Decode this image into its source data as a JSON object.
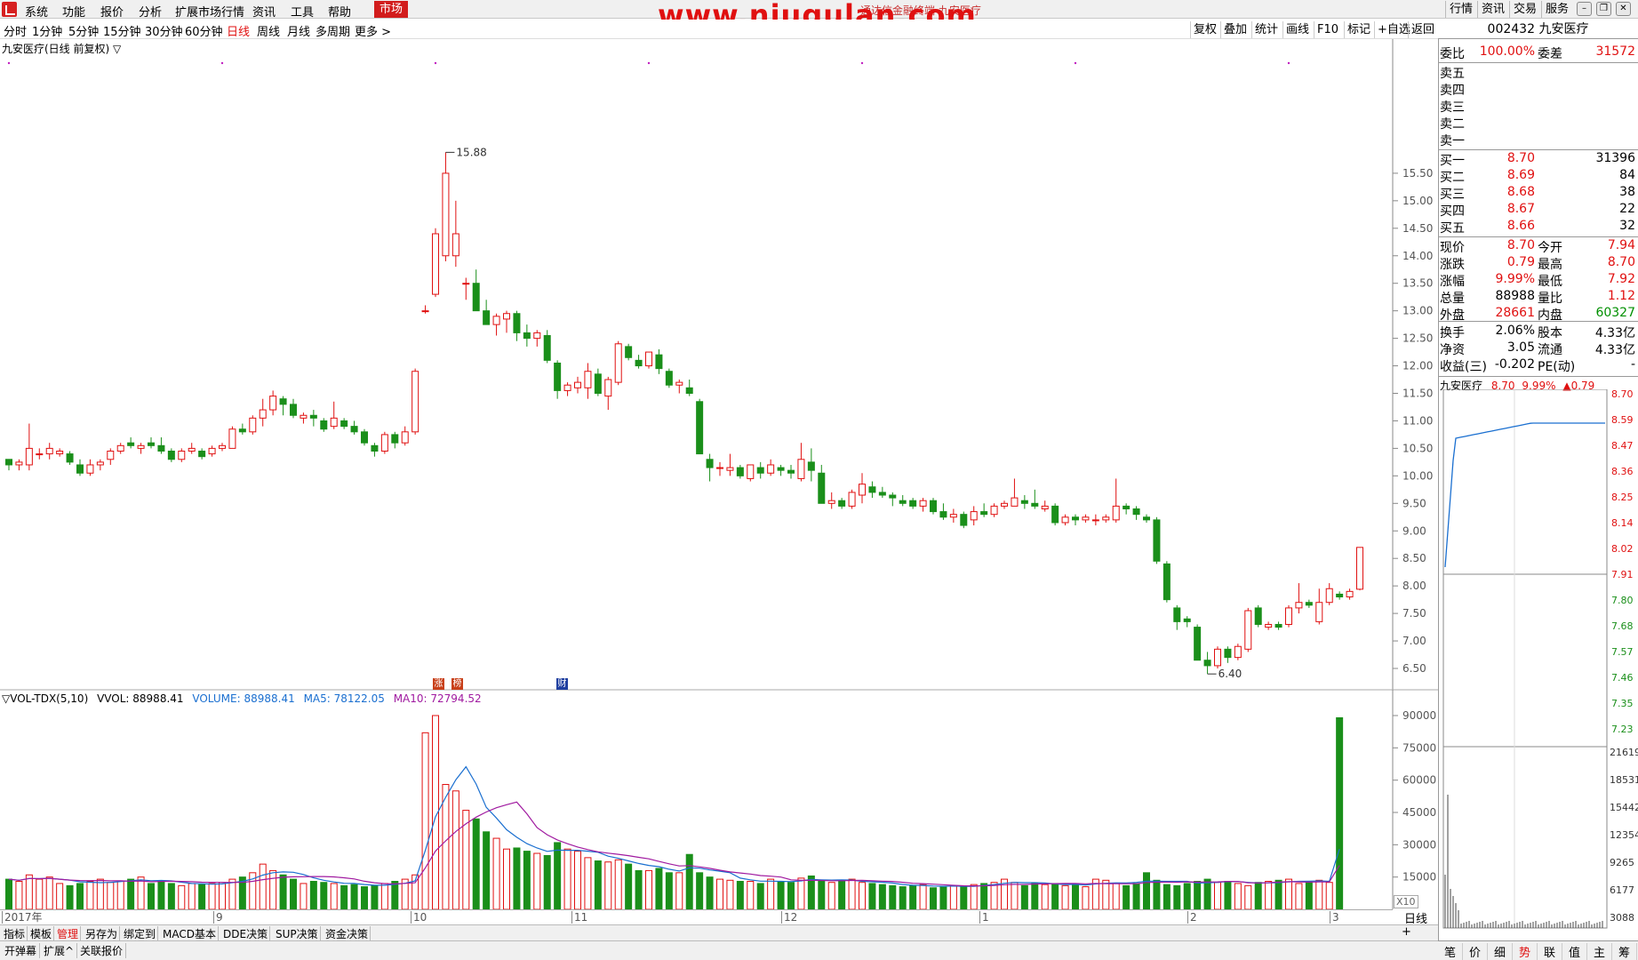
{
  "menu": {
    "items": [
      "系统",
      "功能",
      "报价",
      "分析",
      "扩展市场行情",
      "资讯",
      "工具",
      "帮助"
    ],
    "market": "市场",
    "watermark": "www.niugulan.com",
    "title": "通达信金融终端  九安医疗",
    "right_buttons": [
      "行情",
      "资讯",
      "交易",
      "服务"
    ]
  },
  "periods": [
    "分时",
    "1分钟",
    "5分钟",
    "15分钟",
    "30分钟",
    "60分钟",
    "日线",
    "周线",
    "月线",
    "多周期",
    "更多 >"
  ],
  "active_period": "日线",
  "toolbar": [
    "复权",
    "叠加",
    "统计",
    "画线",
    "F10",
    "标记",
    "+自选",
    "返回"
  ],
  "chart": {
    "title": "九安医疗(日线 前复权) ▽",
    "high_label": "15.88",
    "low_label": "6.40",
    "date_labels": [
      "2017年",
      "9",
      "10",
      "11",
      "12",
      "1",
      "2",
      "3"
    ],
    "freq_label": "日线",
    "x10_label": "X10",
    "badges": [
      "涨",
      "榜",
      "财"
    ]
  },
  "volume": {
    "name": "▽VOL-TDX(5,10)",
    "vvol": "VVOL: 88988.41",
    "volume": "VOLUME: 88988.41",
    "ma5": "MA5: 78122.05",
    "ma10": "MA10: 72794.52"
  },
  "bottom_tabs": [
    "指标",
    "模板",
    "管理",
    "另存为",
    "绑定到",
    "MACD基本",
    "DDE决策",
    "SUP决策",
    "资金决策"
  ],
  "active_tab": "管理",
  "bottom_bar": [
    "开弹幕",
    "扩展^",
    "关联报价"
  ],
  "plus_label": "+",
  "quote": {
    "code_name": "002432 九安医疗",
    "weibi_label": "委比",
    "weibi": "100.00%",
    "weicha_label": "委差",
    "weicha": "31572",
    "sell": [
      {
        "label": "卖五",
        "price": "",
        "vol": ""
      },
      {
        "label": "卖四",
        "price": "",
        "vol": ""
      },
      {
        "label": "卖三",
        "price": "",
        "vol": ""
      },
      {
        "label": "卖二",
        "price": "",
        "vol": ""
      },
      {
        "label": "卖一",
        "price": "",
        "vol": ""
      }
    ],
    "buy": [
      {
        "label": "买一",
        "price": "8.70",
        "vol": "31396"
      },
      {
        "label": "买二",
        "price": "8.69",
        "vol": "84"
      },
      {
        "label": "买三",
        "price": "8.68",
        "vol": "38"
      },
      {
        "label": "买四",
        "price": "8.67",
        "vol": "22"
      },
      {
        "label": "买五",
        "price": "8.66",
        "vol": "32"
      }
    ],
    "stats": [
      {
        "l1": "现价",
        "v1": "8.70",
        "c1": "red",
        "l2": "今开",
        "v2": "7.94",
        "c2": "red"
      },
      {
        "l1": "涨跌",
        "v1": "0.79",
        "c1": "red",
        "l2": "最高",
        "v2": "8.70",
        "c2": "red"
      },
      {
        "l1": "涨幅",
        "v1": "9.99%",
        "c1": "red",
        "l2": "最低",
        "v2": "7.92",
        "c2": "red"
      },
      {
        "l1": "总量",
        "v1": "88988",
        "c1": "",
        "l2": "量比",
        "v2": "1.12",
        "c2": "red"
      },
      {
        "l1": "外盘",
        "v1": "28661",
        "c1": "red",
        "l2": "内盘",
        "v2": "60327",
        "c2": "green"
      }
    ],
    "fundamentals": [
      {
        "l1": "换手",
        "v1": "2.06%",
        "l2": "股本",
        "v2": "4.33亿"
      },
      {
        "l1": "净资",
        "v1": "3.05",
        "l2": "流通",
        "v2": "4.33亿"
      },
      {
        "l1": "收益(三)",
        "v1": "-0.202",
        "l2": "PE(动)",
        "v2": "-"
      }
    ]
  },
  "mini": {
    "name": "九安医疗",
    "price": "8.70",
    "pct": "9.99%",
    "chg": "▲0.79",
    "price_ticks": [
      "8.70",
      "8.59",
      "8.47",
      "8.36",
      "8.25",
      "8.14",
      "8.02",
      "7.91",
      "7.80",
      "7.68",
      "7.57",
      "7.46",
      "7.35",
      "7.23"
    ],
    "vol_ticks": [
      "21619",
      "18531",
      "15442",
      "12354",
      "9265",
      "6177",
      "3088"
    ]
  },
  "right_bottom": [
    "笔",
    "价",
    "细",
    "势",
    "联",
    "值",
    "主",
    "筹"
  ],
  "right_active": "势",
  "colors": {
    "up": "#e01010",
    "down": "#1a8f1a",
    "ma5": "#1a6fd0",
    "ma10": "#a01aa0",
    "bg": "#ffffff"
  },
  "chart_data": {
    "type": "candlestick",
    "price_axis": [
      6.5,
      7.0,
      7.5,
      8.0,
      8.5,
      9.0,
      9.5,
      10.0,
      10.5,
      11.0,
      11.5,
      12.0,
      12.5,
      13.0,
      13.5,
      14.0,
      14.5,
      15.0,
      15.5
    ],
    "volume_axis": [
      15000,
      30000,
      45000,
      60000,
      75000,
      90000
    ],
    "ohlc": [
      [
        10.3,
        10.3,
        10.1,
        10.2
      ],
      [
        10.2,
        10.3,
        10.1,
        10.25
      ],
      [
        10.2,
        10.95,
        10.1,
        10.5
      ],
      [
        10.4,
        10.5,
        10.3,
        10.4
      ],
      [
        10.4,
        10.6,
        10.3,
        10.5
      ],
      [
        10.4,
        10.5,
        10.35,
        10.45
      ],
      [
        10.4,
        10.45,
        10.2,
        10.25
      ],
      [
        10.2,
        10.3,
        10.0,
        10.05
      ],
      [
        10.05,
        10.3,
        10.0,
        10.2
      ],
      [
        10.2,
        10.3,
        10.1,
        10.25
      ],
      [
        10.3,
        10.5,
        10.2,
        10.45
      ],
      [
        10.45,
        10.6,
        10.4,
        10.55
      ],
      [
        10.6,
        10.7,
        10.5,
        10.55
      ],
      [
        10.5,
        10.6,
        10.4,
        10.55
      ],
      [
        10.6,
        10.7,
        10.5,
        10.55
      ],
      [
        10.55,
        10.7,
        10.4,
        10.45
      ],
      [
        10.45,
        10.5,
        10.25,
        10.3
      ],
      [
        10.3,
        10.5,
        10.25,
        10.45
      ],
      [
        10.45,
        10.6,
        10.4,
        10.5
      ],
      [
        10.45,
        10.5,
        10.3,
        10.35
      ],
      [
        10.4,
        10.55,
        10.35,
        10.5
      ],
      [
        10.5,
        10.6,
        10.45,
        10.55
      ],
      [
        10.5,
        10.9,
        10.5,
        10.85
      ],
      [
        10.85,
        10.95,
        10.75,
        10.8
      ],
      [
        10.8,
        11.1,
        10.75,
        11.05
      ],
      [
        11.05,
        11.4,
        10.9,
        11.2
      ],
      [
        11.2,
        11.55,
        11.1,
        11.45
      ],
      [
        11.4,
        11.45,
        11.1,
        11.3
      ],
      [
        11.3,
        11.4,
        11.05,
        11.1
      ],
      [
        11.05,
        11.15,
        10.95,
        11.1
      ],
      [
        11.1,
        11.2,
        10.9,
        11.05
      ],
      [
        11.0,
        11.05,
        10.8,
        10.85
      ],
      [
        10.9,
        11.35,
        10.85,
        11.05
      ],
      [
        11.0,
        11.05,
        10.85,
        10.9
      ],
      [
        10.9,
        11.0,
        10.75,
        10.8
      ],
      [
        10.8,
        10.85,
        10.55,
        10.6
      ],
      [
        10.55,
        10.6,
        10.35,
        10.45
      ],
      [
        10.45,
        10.8,
        10.4,
        10.75
      ],
      [
        10.75,
        10.8,
        10.5,
        10.6
      ],
      [
        10.6,
        10.9,
        10.55,
        10.8
      ],
      [
        10.8,
        11.95,
        10.75,
        11.9
      ],
      [
        13.0,
        13.1,
        12.95,
        13.0
      ],
      [
        13.3,
        14.5,
        13.25,
        14.4
      ],
      [
        14.0,
        15.88,
        13.9,
        15.5
      ],
      [
        14.0,
        15.0,
        13.8,
        14.4
      ],
      [
        13.5,
        13.6,
        13.2,
        13.5
      ],
      [
        13.5,
        13.75,
        13.05,
        13.0
      ],
      [
        13.0,
        13.2,
        12.75,
        12.75
      ],
      [
        12.75,
        12.95,
        12.55,
        12.9
      ],
      [
        12.85,
        13.0,
        12.6,
        12.95
      ],
      [
        12.95,
        13.0,
        12.45,
        12.6
      ],
      [
        12.6,
        12.75,
        12.35,
        12.5
      ],
      [
        12.5,
        12.65,
        12.35,
        12.6
      ],
      [
        12.55,
        12.65,
        12.05,
        12.1
      ],
      [
        12.05,
        12.1,
        11.4,
        11.55
      ],
      [
        11.55,
        11.7,
        11.45,
        11.65
      ],
      [
        11.6,
        11.8,
        11.5,
        11.7
      ],
      [
        11.6,
        12.05,
        11.4,
        11.9
      ],
      [
        11.85,
        11.95,
        11.45,
        11.5
      ],
      [
        11.45,
        11.8,
        11.2,
        11.75
      ],
      [
        11.7,
        12.45,
        11.65,
        12.4
      ],
      [
        12.35,
        12.4,
        12.1,
        12.15
      ],
      [
        12.1,
        12.2,
        11.95,
        12.0
      ],
      [
        12.0,
        12.25,
        11.95,
        12.25
      ],
      [
        12.2,
        12.3,
        11.85,
        11.95
      ],
      [
        11.9,
        11.95,
        11.6,
        11.65
      ],
      [
        11.65,
        11.75,
        11.5,
        11.7
      ],
      [
        11.6,
        11.75,
        11.45,
        11.5
      ],
      [
        11.35,
        11.4,
        10.4,
        10.4
      ],
      [
        10.3,
        10.4,
        9.9,
        10.15
      ],
      [
        10.15,
        10.25,
        10.0,
        10.15
      ],
      [
        10.1,
        10.4,
        10.0,
        10.15
      ],
      [
        10.15,
        10.2,
        9.95,
        10.0
      ],
      [
        9.95,
        10.2,
        9.9,
        10.2
      ],
      [
        10.15,
        10.25,
        9.95,
        10.05
      ],
      [
        10.05,
        10.3,
        10.0,
        10.2
      ],
      [
        10.15,
        10.2,
        10.0,
        10.1
      ],
      [
        10.1,
        10.2,
        9.95,
        10.05
      ],
      [
        9.95,
        10.6,
        9.9,
        10.3
      ],
      [
        10.25,
        10.5,
        9.9,
        10.1
      ],
      [
        10.05,
        10.2,
        9.5,
        9.5
      ],
      [
        9.5,
        9.7,
        9.4,
        9.55
      ],
      [
        9.55,
        9.6,
        9.4,
        9.45
      ],
      [
        9.45,
        9.75,
        9.4,
        9.7
      ],
      [
        9.65,
        10.05,
        9.5,
        9.85
      ],
      [
        9.8,
        9.9,
        9.6,
        9.7
      ],
      [
        9.7,
        9.8,
        9.6,
        9.65
      ],
      [
        9.65,
        9.7,
        9.45,
        9.6
      ],
      [
        9.55,
        9.65,
        9.45,
        9.5
      ],
      [
        9.55,
        9.6,
        9.4,
        9.45
      ],
      [
        9.45,
        9.6,
        9.35,
        9.55
      ],
      [
        9.55,
        9.6,
        9.3,
        9.35
      ],
      [
        9.35,
        9.5,
        9.2,
        9.25
      ],
      [
        9.25,
        9.4,
        9.15,
        9.3
      ],
      [
        9.3,
        9.35,
        9.05,
        9.1
      ],
      [
        9.2,
        9.45,
        9.1,
        9.35
      ],
      [
        9.35,
        9.5,
        9.25,
        9.3
      ],
      [
        9.3,
        9.5,
        9.25,
        9.45
      ],
      [
        9.45,
        9.55,
        9.4,
        9.5
      ],
      [
        9.45,
        9.95,
        9.45,
        9.6
      ],
      [
        9.55,
        9.65,
        9.4,
        9.5
      ],
      [
        9.5,
        9.75,
        9.4,
        9.45
      ],
      [
        9.4,
        9.55,
        9.35,
        9.45
      ],
      [
        9.45,
        9.5,
        9.1,
        9.15
      ],
      [
        9.15,
        9.3,
        9.1,
        9.25
      ],
      [
        9.25,
        9.3,
        9.1,
        9.2
      ],
      [
        9.2,
        9.3,
        9.15,
        9.25
      ],
      [
        9.2,
        9.3,
        9.1,
        9.2
      ],
      [
        9.2,
        9.3,
        9.15,
        9.25
      ],
      [
        9.2,
        9.95,
        9.15,
        9.45
      ],
      [
        9.45,
        9.5,
        9.3,
        9.4
      ],
      [
        9.4,
        9.45,
        9.2,
        9.3
      ],
      [
        9.25,
        9.3,
        9.15,
        9.2
      ],
      [
        9.2,
        9.25,
        8.4,
        8.45
      ],
      [
        8.4,
        8.45,
        7.7,
        7.75
      ],
      [
        7.6,
        7.65,
        7.2,
        7.35
      ],
      [
        7.4,
        7.45,
        7.25,
        7.35
      ],
      [
        7.25,
        7.3,
        6.65,
        6.65
      ],
      [
        6.65,
        6.8,
        6.4,
        6.55
      ],
      [
        6.55,
        6.9,
        6.5,
        6.85
      ],
      [
        6.85,
        6.9,
        6.6,
        6.7
      ],
      [
        6.7,
        6.95,
        6.65,
        6.9
      ],
      [
        6.85,
        7.6,
        6.8,
        7.55
      ],
      [
        7.6,
        7.65,
        7.25,
        7.3
      ],
      [
        7.25,
        7.35,
        7.2,
        7.3
      ],
      [
        7.3,
        7.35,
        7.2,
        7.25
      ],
      [
        7.3,
        7.65,
        7.25,
        7.6
      ],
      [
        7.6,
        8.05,
        7.5,
        7.7
      ],
      [
        7.7,
        7.75,
        7.6,
        7.65
      ],
      [
        7.35,
        7.95,
        7.3,
        7.7
      ],
      [
        7.7,
        8.05,
        7.65,
        7.95
      ],
      [
        7.85,
        7.9,
        7.75,
        7.8
      ],
      [
        7.8,
        7.95,
        7.75,
        7.9
      ],
      [
        7.94,
        8.7,
        7.92,
        8.7
      ]
    ],
    "volume": [
      14000,
      13000,
      16000,
      14000,
      15000,
      12000,
      11000,
      12000,
      13000,
      14000,
      12500,
      13000,
      14000,
      15000,
      12000,
      13000,
      12000,
      11000,
      12000,
      11500,
      12000,
      12500,
      14000,
      15000,
      17000,
      21000,
      18000,
      16000,
      14000,
      12000,
      13000,
      12500,
      12000,
      11000,
      11500,
      10500,
      11000,
      12000,
      13000,
      14000,
      16000,
      82000,
      90000,
      58000,
      55000,
      46000,
      42000,
      36000,
      33000,
      28000,
      28500,
      27000,
      26000,
      25000,
      31000,
      28000,
      27000,
      24000,
      22500,
      22000,
      23000,
      21000,
      18000,
      18000,
      19000,
      17000,
      17000,
      25500,
      17000,
      15000,
      14000,
      13500,
      13000,
      13000,
      12000,
      14000,
      13000,
      12500,
      14500,
      15500,
      13000,
      12500,
      13000,
      14000,
      12500,
      12000,
      11500,
      11000,
      10500,
      11000,
      11500,
      10000,
      10500,
      11000,
      10500,
      11500,
      12000,
      12500,
      14000,
      12500,
      11000,
      12000,
      11500,
      12000,
      11000,
      11500,
      10500,
      14000,
      13500,
      12000,
      11000,
      12000,
      17000,
      13500,
      11500,
      11000,
      12000,
      13000,
      14000,
      12500,
      13000,
      12000,
      11000,
      12500,
      13000,
      13500,
      14000,
      12000,
      13000,
      13500,
      12500,
      88988
    ]
  }
}
